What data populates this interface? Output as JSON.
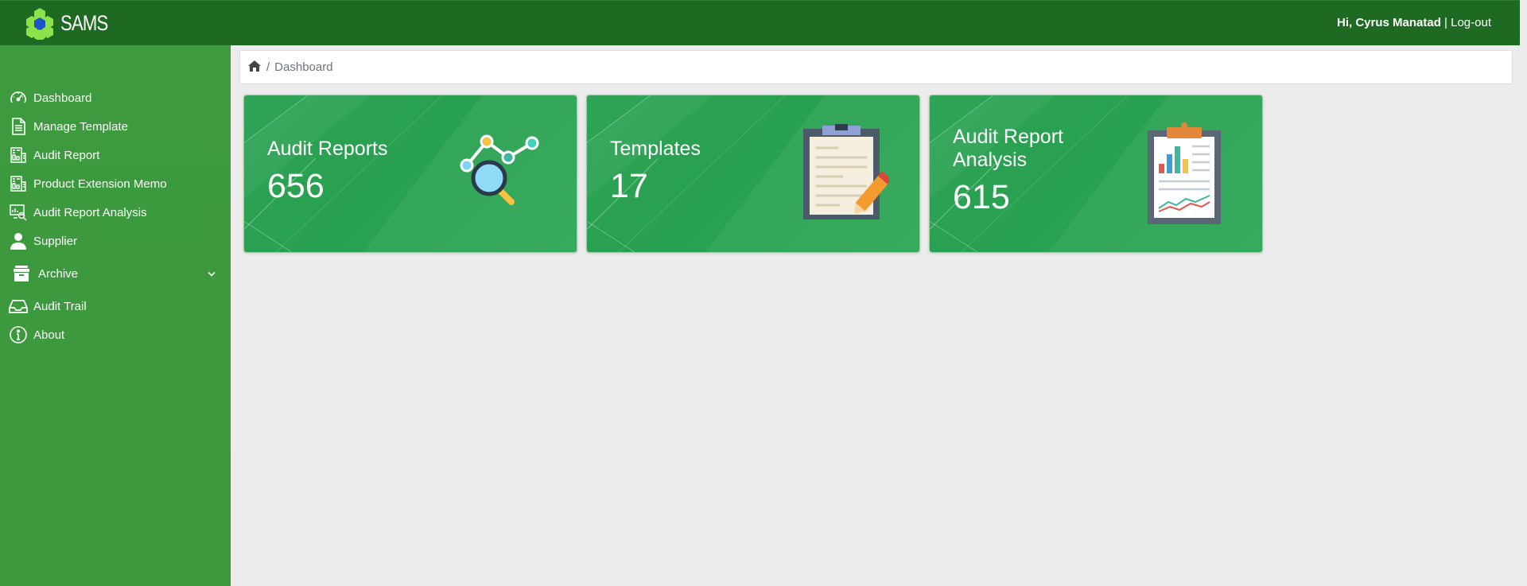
{
  "app": {
    "name": "SAMS"
  },
  "header": {
    "greeting": "Hi, Cyrus Manatad",
    "separator": "|",
    "logout_label": "Log-out"
  },
  "sidebar": {
    "items": [
      {
        "label": "Dashboard",
        "icon": "dashboard-gauge-icon"
      },
      {
        "label": "Manage Template",
        "icon": "document-icon"
      },
      {
        "label": "Audit Report",
        "icon": "report-icon"
      },
      {
        "label": "Product Extension Memo",
        "icon": "memo-icon"
      },
      {
        "label": "Audit Report Analysis",
        "icon": "analysis-icon"
      },
      {
        "label": "Supplier",
        "icon": "user-icon"
      },
      {
        "label": "Archive",
        "icon": "archive-box-icon"
      },
      {
        "label": "Audit Trail",
        "icon": "inbox-tray-icon"
      },
      {
        "label": "About",
        "icon": "info-icon"
      }
    ]
  },
  "breadcrumb": {
    "home_icon": "home-icon",
    "separator": "/",
    "current": "Dashboard"
  },
  "cards": [
    {
      "title": "Audit Reports",
      "value": "656",
      "icon": "chart-magnifier-icon"
    },
    {
      "title": "Templates",
      "value": "17",
      "icon": "clipboard-pencil-icon"
    },
    {
      "title_line1": "Audit Report",
      "title_line2": "Analysis",
      "value": "615",
      "icon": "clipboard-chart-icon"
    }
  ],
  "colors": {
    "header": "#1e6a22",
    "sidebar": "#3d9a3f",
    "card": "#2aa553",
    "background": "#ececec"
  }
}
